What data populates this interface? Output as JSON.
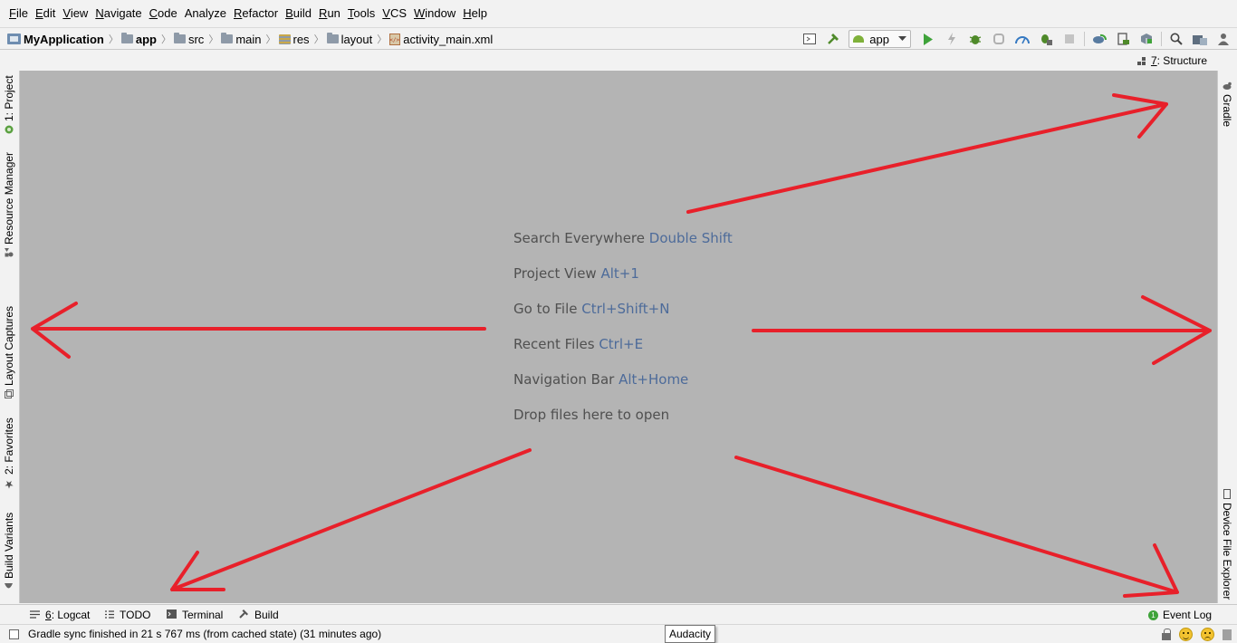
{
  "menu": [
    {
      "label": "File",
      "mnemonic": "F",
      "rest": "ile"
    },
    {
      "label": "Edit",
      "mnemonic": "E",
      "rest": "dit"
    },
    {
      "label": "View",
      "mnemonic": "V",
      "rest": "iew"
    },
    {
      "label": "Navigate",
      "mnemonic": "N",
      "rest": "avigate"
    },
    {
      "label": "Code",
      "mnemonic": "C",
      "rest": "ode"
    },
    {
      "label": "Analyze",
      "mnemonic": "",
      "rest": "Analyze"
    },
    {
      "label": "Refactor",
      "mnemonic": "R",
      "rest": "efactor"
    },
    {
      "label": "Build",
      "mnemonic": "B",
      "rest": "uild"
    },
    {
      "label": "Run",
      "mnemonic": "R",
      "rest": "un"
    },
    {
      "label": "Tools",
      "mnemonic": "T",
      "rest": "ools"
    },
    {
      "label": "VCS",
      "mnemonic": "V",
      "rest": "CS"
    },
    {
      "label": "Window",
      "mnemonic": "W",
      "rest": "indow"
    },
    {
      "label": "Help",
      "mnemonic": "H",
      "rest": "elp"
    }
  ],
  "breadcrumb": [
    "MyApplication",
    "app",
    "src",
    "main",
    "res",
    "layout",
    "activity_main.xml"
  ],
  "toolbar": {
    "run_config": "app",
    "icons": [
      "run-config-icon",
      "hammer-icon",
      "run-icon",
      "apply-changes-icon",
      "debug-icon",
      "attach-debugger-icon",
      "profile-icon",
      "debug-attach-icon",
      "stop-icon",
      "sync-gradle-icon",
      "avd-manager-icon",
      "sdk-manager-icon",
      "search-icon",
      "project-structure-icon",
      "user-icon"
    ]
  },
  "structure_tab": {
    "mnemonic": "7",
    "rest": ": Structure"
  },
  "left_tabs": {
    "project": "1: Project",
    "resource_manager": "Resource Manager",
    "layout_captures": "Layout Captures",
    "favorites": "2: Favorites",
    "build_variants": "Build Variants"
  },
  "right_tabs": {
    "gradle": "Gradle",
    "device_file_explorer": "Device File Explorer"
  },
  "hints": [
    {
      "text": "Search Everywhere",
      "key": "Double Shift"
    },
    {
      "text": "Project View",
      "key": "Alt+1"
    },
    {
      "text": "Go to File",
      "key": "Ctrl+Shift+N"
    },
    {
      "text": "Recent Files",
      "key": "Ctrl+E"
    },
    {
      "text": "Navigation Bar",
      "key": "Alt+Home"
    },
    {
      "text": "Drop files here to open",
      "key": ""
    }
  ],
  "arrow_color": "#e8202a",
  "editor_bg": "#b4b4b4",
  "bottom_tabs": {
    "logcat_mnemonic": "6",
    "logcat_rest": ": Logcat",
    "todo": "TODO",
    "terminal": "Terminal",
    "build": "Build",
    "event_log": "Event Log",
    "event_log_count": "1"
  },
  "status": {
    "message": "Gradle sync finished in 21 s 767 ms (from cached state) (31 minutes ago)",
    "tooltip": "Audacity"
  }
}
